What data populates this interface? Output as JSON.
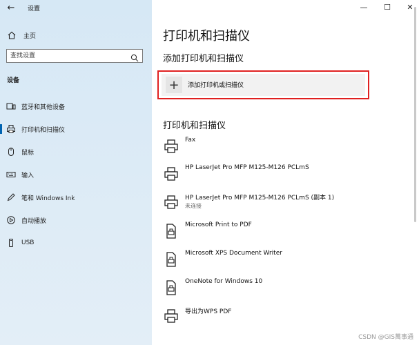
{
  "window": {
    "app_title": "设置",
    "back_glyph": "←",
    "controls": {
      "minimize": "—",
      "maximize": "☐",
      "close": "✕"
    }
  },
  "sidebar": {
    "home_label": "主页",
    "search_placeholder": "查找设置",
    "section_label": "设备",
    "items": [
      {
        "label": "蓝牙和其他设备",
        "icon": "bluetooth-devices-icon"
      },
      {
        "label": "打印机和扫描仪",
        "icon": "printer-icon",
        "active": true
      },
      {
        "label": "鼠标",
        "icon": "mouse-icon"
      },
      {
        "label": "输入",
        "icon": "keyboard-icon"
      },
      {
        "label": "笔和 Windows Ink",
        "icon": "pen-icon"
      },
      {
        "label": "自动播放",
        "icon": "autoplay-icon"
      },
      {
        "label": "USB",
        "icon": "usb-icon"
      }
    ],
    "accent_color": "#0063b1"
  },
  "main": {
    "page_title": "打印机和扫描仪",
    "add_section_title": "添加打印机和扫描仪",
    "add_button_label": "添加打印机或扫描仪",
    "add_button_glyph": "+",
    "list_section_title": "打印机和扫描仪",
    "highlight_color": "#e02020",
    "printers": [
      {
        "name": "Fax",
        "status": "",
        "icon": "printer-icon"
      },
      {
        "name": "HP LaserJet Pro MFP M125-M126 PCLmS",
        "status": "",
        "icon": "printer-icon"
      },
      {
        "name": "HP LaserJet Pro MFP M125-M126 PCLmS (副本 1)",
        "status": "未连接",
        "icon": "printer-icon"
      },
      {
        "name": "Microsoft Print to PDF",
        "status": "",
        "icon": "document-printer-icon"
      },
      {
        "name": "Microsoft XPS Document Writer",
        "status": "",
        "icon": "document-printer-icon"
      },
      {
        "name": "OneNote for Windows 10",
        "status": "",
        "icon": "document-printer-icon"
      },
      {
        "name": "导出为WPS PDF",
        "status": "",
        "icon": "printer-icon"
      }
    ]
  },
  "watermark": "CSDN @GIS萬事通"
}
